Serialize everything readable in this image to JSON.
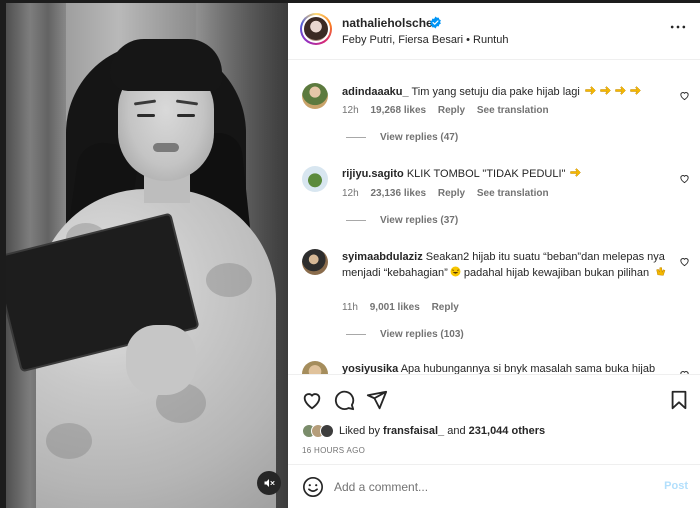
{
  "post": {
    "username": "nathalieholscher",
    "music": "Feby Putri, Fiersa Besari • Runtuh",
    "verified": true
  },
  "comments": [
    {
      "username": "adindaaaku_",
      "text": "Tim yang setuju dia pake hijab lagi",
      "emoji": "pointing-hand-emoji x4",
      "time": "12h",
      "likes": "19,268 likes",
      "reply": "Reply",
      "translate": "See translation",
      "view_replies": "View replies (47)"
    },
    {
      "username": "rijiyu.sagito",
      "text": "KLIK TOMBOL \"TIDAK PEDULI\"",
      "emoji": "pointing-hand-emoji",
      "time": "12h",
      "likes": "23,136 likes",
      "reply": "Reply",
      "translate": "See translation",
      "view_replies": "View replies (37)"
    },
    {
      "username": "syimaabdulaziz",
      "text_part1": "Seakan2 hijab itu suatu “beban”dan melepas nya menjadi “kebahagian”",
      "text_part2": " padahal hijab kewajiban bukan pilihan",
      "emoji": "laughing-emoji, clapping-hands-emoji",
      "time": "11h",
      "likes": "9,001 likes",
      "reply": "Reply",
      "view_replies": "View replies (103)"
    },
    {
      "username": "yosiyusika",
      "text": "Apa hubungannya si bnyk masalah sama buka hijab"
    }
  ],
  "actions": {
    "liked_by_prefix": "Liked by ",
    "liked_by_user": "fransfaisal_",
    "liked_by_middle": " and ",
    "liked_by_count": "231,044 others",
    "timestamp": "16 HOURS AGO"
  },
  "add_comment": {
    "placeholder": "Add a comment...",
    "post_label": "Post"
  },
  "colors": {
    "accent_blue": "#0095f6",
    "verified_blue": "#0095f6",
    "muted_text": "#737373",
    "post_disabled": "#b2dffc"
  },
  "icons": {
    "header_more": "more-horizontal-icon",
    "like": "heart-icon",
    "comment": "comment-icon",
    "share": "paper-plane-icon",
    "save": "bookmark-icon",
    "emoji": "smiley-icon",
    "mute": "speaker-muted-icon"
  }
}
